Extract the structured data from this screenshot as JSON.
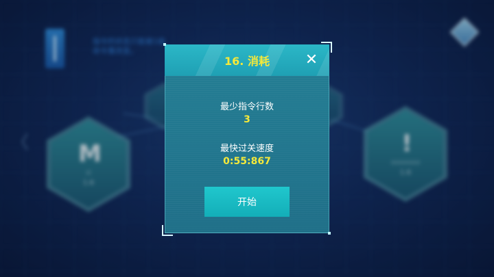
{
  "background": {
    "hint_text_line1": "指令的状态只能被1级",
    "hint_text_line2": "命令重改变。",
    "levels": [
      {
        "glyph": "M",
        "subtitle": "xi",
        "number": "1.6"
      },
      {
        "glyph": "!",
        "subtitle": "xxxxxxxx",
        "number": "1.6"
      }
    ],
    "left_arrow": "〈"
  },
  "dialog": {
    "title": "16. 消耗",
    "close_symbol": "✕",
    "min_instructions_label": "最少指令行数",
    "min_instructions_value": "3",
    "fastest_speed_label": "最快过关速度",
    "fastest_speed_value": "0:55:867",
    "start_label": "开始"
  },
  "colors": {
    "accent_yellow": "#f5e93a",
    "panel_teal": "#247f95",
    "button_teal": "#1bbcc4"
  }
}
